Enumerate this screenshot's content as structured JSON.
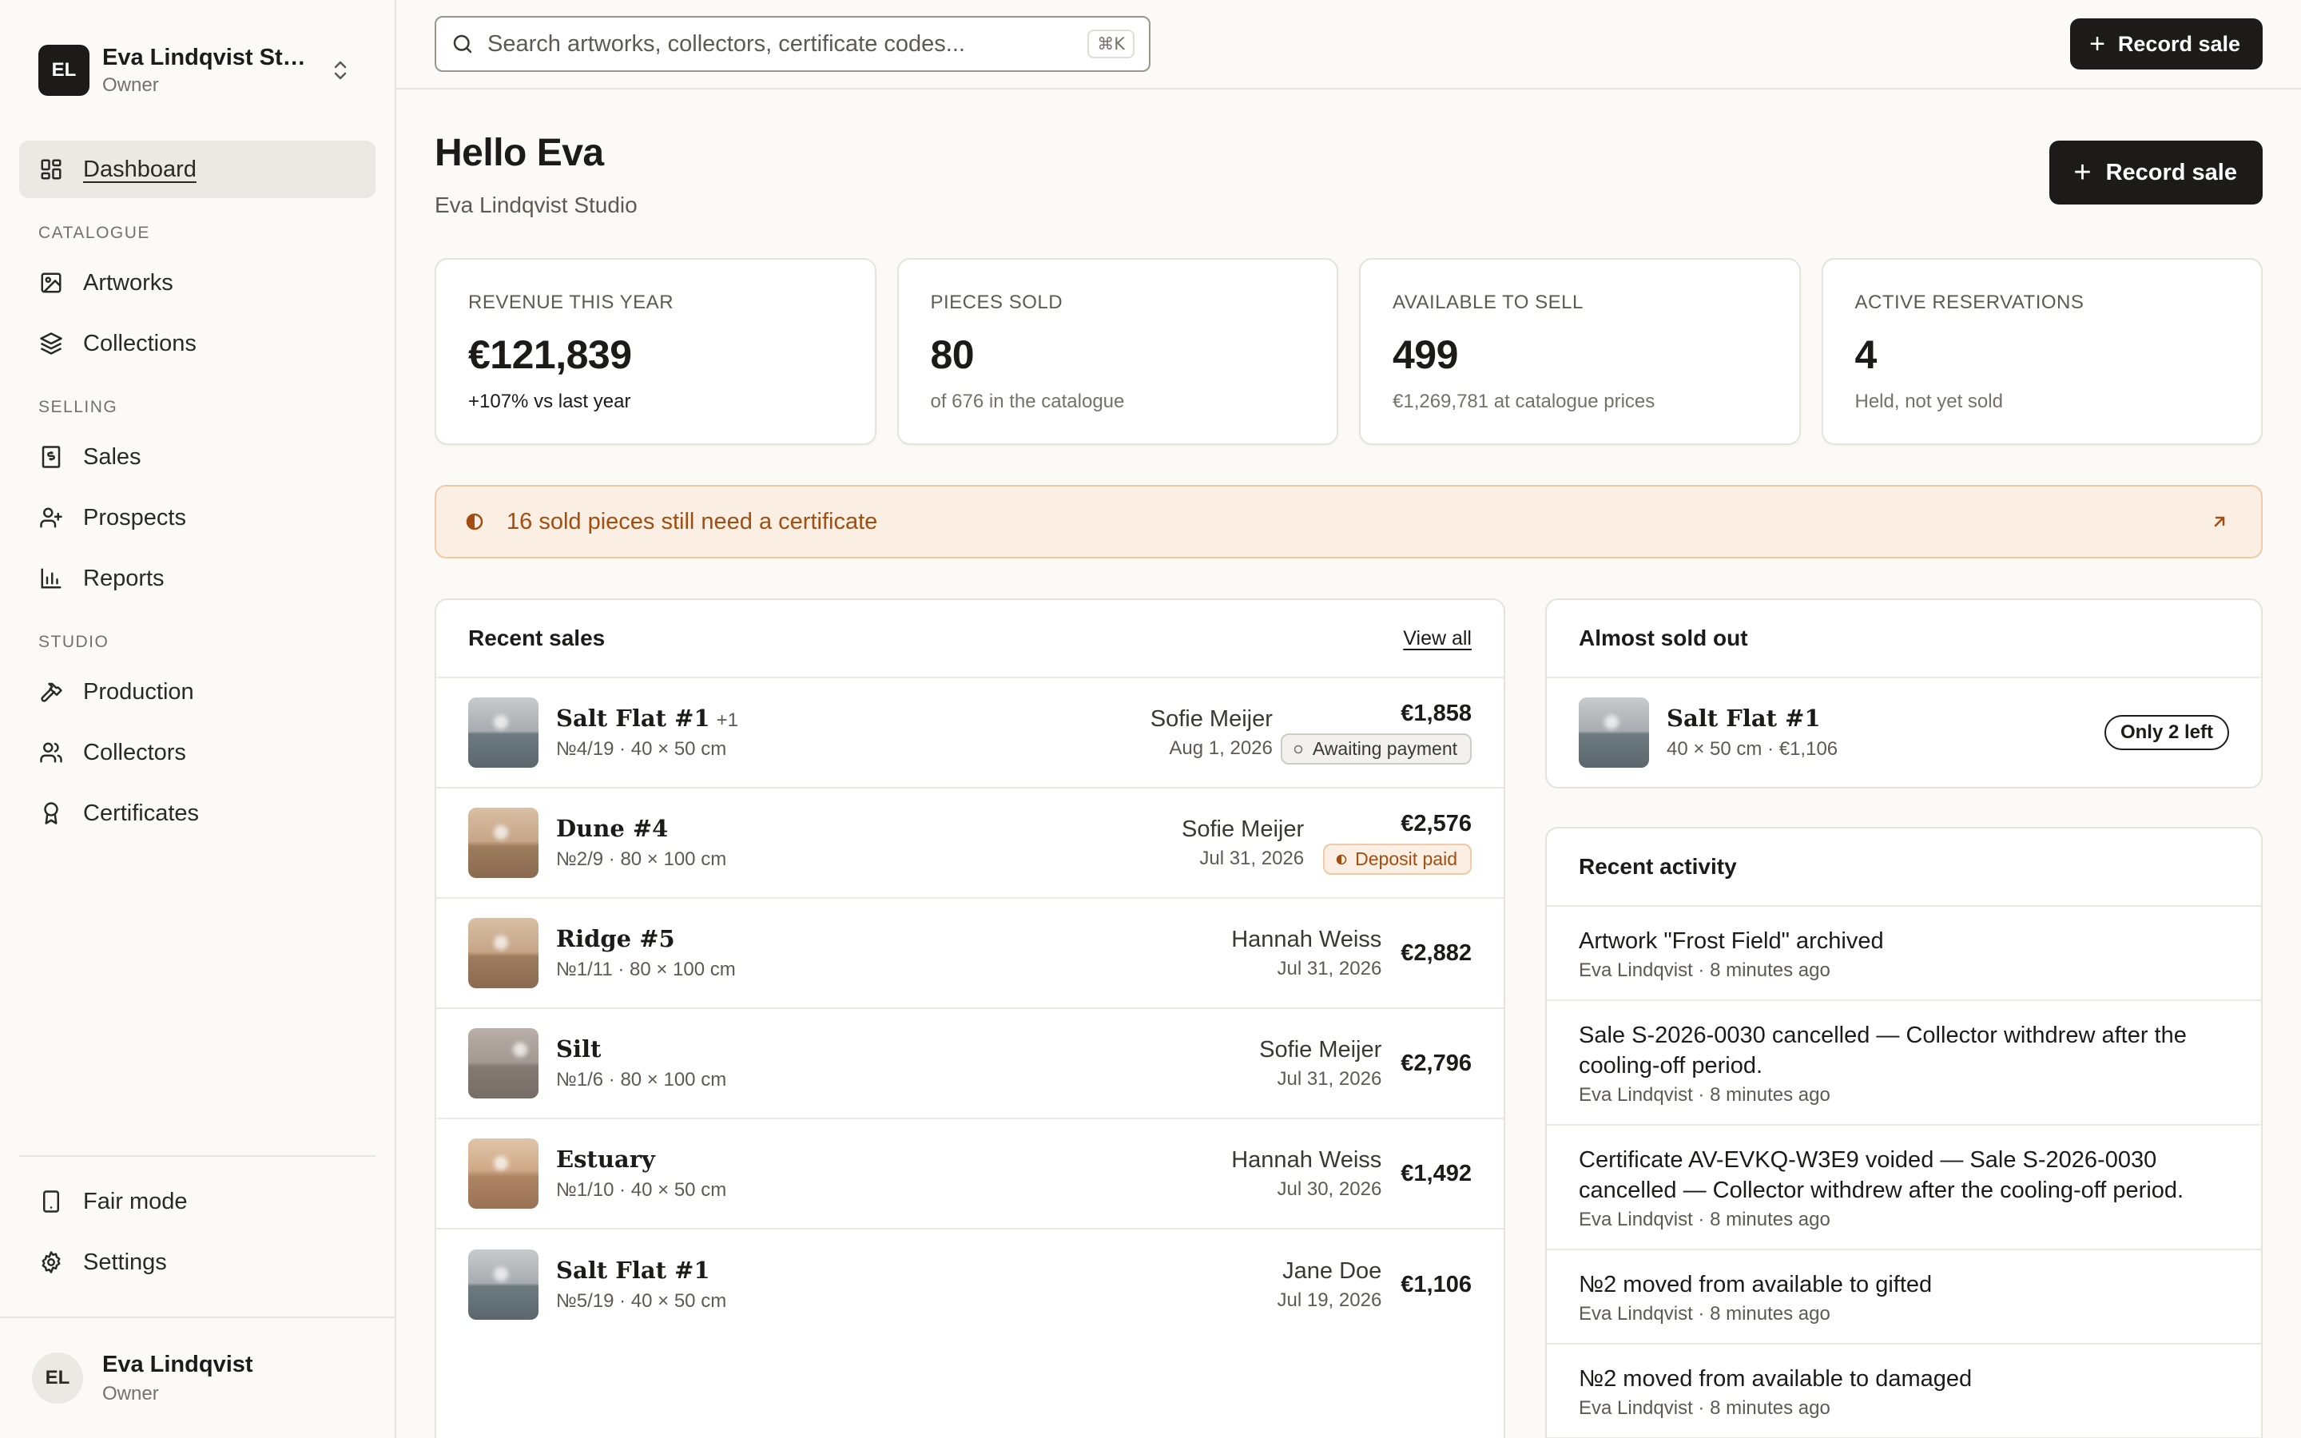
{
  "workspace": {
    "initials": "EL",
    "name": "Eva Lindqvist Stu...",
    "role": "Owner"
  },
  "nav": {
    "dashboard": "Dashboard",
    "section_catalogue": "CATALOGUE",
    "artworks": "Artworks",
    "collections": "Collections",
    "section_selling": "SELLING",
    "sales": "Sales",
    "prospects": "Prospects",
    "reports": "Reports",
    "section_studio": "STUDIO",
    "production": "Production",
    "collectors": "Collectors",
    "certificates": "Certificates",
    "fair_mode": "Fair mode",
    "settings": "Settings"
  },
  "user": {
    "initials": "EL",
    "name": "Eva Lindqvist",
    "role": "Owner"
  },
  "search": {
    "placeholder": "Search artworks, collectors, certificate codes...",
    "shortcut": "⌘K"
  },
  "topbar": {
    "record_sale": "Record sale"
  },
  "header": {
    "greeting": "Hello Eva",
    "subtitle": "Eva Lindqvist Studio",
    "record_sale": "Record sale"
  },
  "stats": [
    {
      "label": "REVENUE THIS YEAR",
      "value": "€121,839",
      "note": "+107% vs last year"
    },
    {
      "label": "PIECES SOLD",
      "value": "80",
      "note": "of 676 in the catalogue"
    },
    {
      "label": "AVAILABLE TO SELL",
      "value": "499",
      "note": "€1,269,781 at catalogue prices"
    },
    {
      "label": "ACTIVE RESERVATIONS",
      "value": "4",
      "note": "Held, not yet sold"
    }
  ],
  "alert": {
    "text": "16 sold pieces still need a certificate"
  },
  "recent_sales": {
    "title": "Recent sales",
    "view_all": "View all",
    "rows": [
      {
        "title": "Salt Flat #1",
        "extra": "+1",
        "meta": "№4/19 · 40 × 50 cm",
        "buyer": "Sofie Meijer",
        "date": "Aug 1, 2026",
        "price": "€1,858",
        "badge": "Awaiting payment"
      },
      {
        "title": "Dune #4",
        "extra": "",
        "meta": "№2/9 · 80 × 100 cm",
        "buyer": "Sofie Meijer",
        "date": "Jul 31, 2026",
        "price": "€2,576",
        "badge": "Deposit paid"
      },
      {
        "title": "Ridge #5",
        "extra": "",
        "meta": "№1/11 · 80 × 100 cm",
        "buyer": "Hannah Weiss",
        "date": "Jul 31, 2026",
        "price": "€2,882",
        "badge": ""
      },
      {
        "title": "Silt",
        "extra": "",
        "meta": "№1/6 · 80 × 100 cm",
        "buyer": "Sofie Meijer",
        "date": "Jul 31, 2026",
        "price": "€2,796",
        "badge": ""
      },
      {
        "title": "Estuary",
        "extra": "",
        "meta": "№1/10 · 40 × 50 cm",
        "buyer": "Hannah Weiss",
        "date": "Jul 30, 2026",
        "price": "€1,492",
        "badge": ""
      },
      {
        "title": "Salt Flat #1",
        "extra": "",
        "meta": "№5/19 · 40 × 50 cm",
        "buyer": "Jane Doe",
        "date": "Jul 19, 2026",
        "price": "€1,106",
        "badge": ""
      }
    ]
  },
  "almost_sold_out": {
    "title": "Almost sold out",
    "item": {
      "title": "Salt Flat #1",
      "meta": "40 × 50 cm · €1,106",
      "badge": "Only 2 left"
    }
  },
  "recent_activity": {
    "title": "Recent activity",
    "rows": [
      {
        "text": "Artwork \"Frost Field\" archived",
        "meta": "Eva Lindqvist · 8 minutes ago"
      },
      {
        "text": "Sale S-2026-0030 cancelled — Collector withdrew after the cooling-off period.",
        "meta": "Eva Lindqvist · 8 minutes ago"
      },
      {
        "text": "Certificate AV-EVKQ-W3E9 voided — Sale S-2026-0030 cancelled — Collector withdrew after the cooling-off period.",
        "meta": "Eva Lindqvist · 8 minutes ago"
      },
      {
        "text": "№2 moved from available to gifted",
        "meta": "Eva Lindqvist · 8 minutes ago"
      },
      {
        "text": "№2 moved from available to damaged",
        "meta": "Eva Lindqvist · 8 minutes ago"
      }
    ]
  },
  "colors": {
    "accent": "#1c1b19",
    "alert_bg": "#fbeee2",
    "alert_text": "#a34d10",
    "background": "#fbfaf7"
  }
}
